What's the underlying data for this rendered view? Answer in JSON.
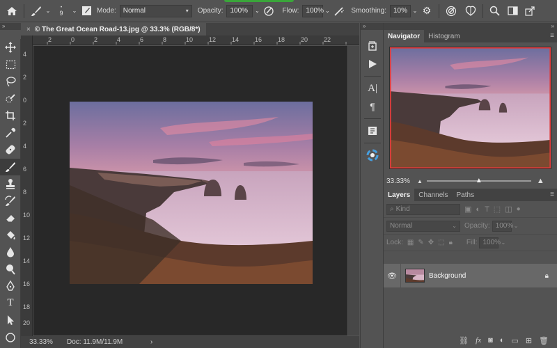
{
  "options_bar": {
    "brush_size": "9",
    "mode_label": "Mode:",
    "mode_value": "Normal",
    "opacity_label": "Opacity:",
    "opacity_value": "100%",
    "flow_label": "Flow:",
    "flow_value": "100%",
    "smoothing_label": "Smoothing:",
    "smoothing_value": "10%",
    "icons": [
      "home-icon",
      "brush-icon",
      "brush-preset-icon",
      "brush-panel-icon",
      "pressure-opacity-icon",
      "airbrush-icon",
      "gear-icon",
      "pressure-size-icon",
      "symmetry-icon",
      "search-icon",
      "workspace-icon",
      "share-icon"
    ]
  },
  "collapse_glyph": "»",
  "document": {
    "close_glyph": "×",
    "tab_title": "© The Great Ocean Road-13.jpg @ 33.3% (RGB/8*)",
    "ruler_top": [
      "2",
      "0",
      "2",
      "4",
      "6",
      "8",
      "10",
      "12",
      "14",
      "16",
      "18",
      "20",
      "22"
    ],
    "ruler_left": [
      "4",
      "2",
      "0",
      "2",
      "4",
      "6",
      "8",
      "10",
      "12",
      "14",
      "16",
      "18",
      "20",
      "22"
    ]
  },
  "status_bar": {
    "zoom": "33.33%",
    "doc_info": "Doc: 11.9M/11.9M",
    "arrow": "›"
  },
  "toolbar": {
    "tools": [
      "move-tool-icon",
      "marquee-tool-icon",
      "lasso-tool-icon",
      "quick-select-tool-icon",
      "crop-tool-icon",
      "eyedropper-tool-icon",
      "healing-brush-tool-icon",
      "brush-tool-icon",
      "clone-stamp-tool-icon",
      "history-brush-tool-icon",
      "eraser-tool-icon",
      "paint-bucket-tool-icon",
      "blur-tool-icon",
      "dodge-tool-icon",
      "pen-tool-icon",
      "type-tool-icon",
      "path-select-tool-icon",
      "shape-tool-icon"
    ],
    "active_index": 7
  },
  "mid_strip": {
    "icons": [
      "history-panel-icon",
      "actions-panel-icon",
      "character-panel-icon",
      "paragraph-panel-icon",
      "glyphs-panel-icon",
      "color-panel-icon"
    ]
  },
  "navigator": {
    "tabs": [
      "Navigator",
      "Histogram"
    ],
    "active_tab": "Navigator",
    "zoom": "33.33%",
    "menu_glyph": "≡"
  },
  "layers_panel": {
    "tabs": [
      "Layers",
      "Channels",
      "Paths"
    ],
    "active_tab": "Layers",
    "menu_glyph": "≡",
    "filter_placeholder": "Kind",
    "blend_mode": "Normal",
    "opacity_label": "Opacity:",
    "opacity_value": "100%",
    "lock_label": "Lock:",
    "fill_label": "Fill:",
    "fill_value": "100%",
    "layers": [
      {
        "name": "Background",
        "visible": true,
        "locked": true
      }
    ],
    "footer_icons": [
      "link-layers-icon",
      "fx-icon",
      "mask-icon",
      "adjustment-icon",
      "group-icon",
      "new-layer-icon",
      "trash-icon"
    ]
  },
  "colors": {
    "ui_bg": "#535353",
    "dark_bg": "#424242",
    "canvas_bg": "#282828",
    "selected_layer": "#686868",
    "nav_box": "#e23b3b",
    "indicator_green": "#3aa53a"
  }
}
